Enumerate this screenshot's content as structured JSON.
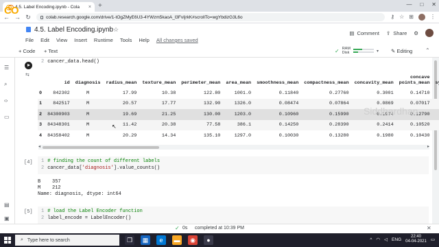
{
  "browser": {
    "tab_title": "4.5. Label Encoding.ipynb - Cola",
    "tab_close": "×",
    "new_tab": "+",
    "url": "colab.research.google.com/drive/1-tOgZMyE6U3-4YWzm5kaoA_l3FvIjrkK#scrollTo=wgYbdizG3L6o"
  },
  "colab": {
    "logo": "CO",
    "notebook_title": "4.5. Label Encoding.ipynb",
    "menu": [
      "File",
      "Edit",
      "View",
      "Insert",
      "Runtime",
      "Tools",
      "Help"
    ],
    "changes_status": "All changes saved",
    "comment_label": "Comment",
    "share_label": "Share",
    "add_code": "+ Code",
    "add_text": "+ Text",
    "ram_label": "RAM",
    "disk_label": "Disk",
    "ram_fraction": 0.45,
    "disk_fraction": 0.25,
    "editing_label": "Editing"
  },
  "cell1": {
    "line_no": "2",
    "code": "cancer_data.head()"
  },
  "table": {
    "columns": [
      "",
      "id",
      "diagnosis",
      "radius_mean",
      "texture_mean",
      "perimeter_mean",
      "area_mean",
      "smoothness_mean",
      "compactness_mean",
      "concavity_mean",
      "concave points_mean",
      "symm"
    ],
    "rows": [
      [
        "0",
        "842302",
        "M",
        "17.99",
        "10.38",
        "122.80",
        "1001.0",
        "0.11840",
        "0.27760",
        "0.3001",
        "0.14710",
        ""
      ],
      [
        "1",
        "842517",
        "M",
        "20.57",
        "17.77",
        "132.90",
        "1326.0",
        "0.08474",
        "0.07864",
        "0.0869",
        "0.07017",
        ""
      ],
      [
        "2",
        "84300903",
        "M",
        "19.69",
        "21.25",
        "130.00",
        "1203.0",
        "0.10960",
        "0.15990",
        "0.1974",
        "0.12790",
        ""
      ],
      [
        "3",
        "84348301",
        "M",
        "11.42",
        "20.38",
        "77.58",
        "386.1",
        "0.14250",
        "0.28390",
        "0.2414",
        "0.10520",
        ""
      ],
      [
        "4",
        "84358402",
        "M",
        "20.29",
        "14.34",
        "135.10",
        "1297.0",
        "0.10030",
        "0.13280",
        "0.1980",
        "0.10430",
        ""
      ]
    ]
  },
  "watermark": "Siddhardhan",
  "cell4": {
    "number": "[4]",
    "line1_no": "1",
    "line1": "# finding the count of different labels",
    "line2_no": "2",
    "line2_prefix": "cancer_data[",
    "line2_string": "'diagnosis'",
    "line2_suffix": "].value_counts()",
    "output": [
      "B    357",
      "M    212",
      "Name: diagnosis, dtype: int64"
    ]
  },
  "cell5": {
    "number": "[5]",
    "line1_no": "1",
    "line1": "# load the Label Encoder function",
    "line2_no": "2",
    "line2": "label_encode = LabelEncoder()"
  },
  "status": {
    "check": "✓",
    "time": "0s",
    "message": "completed at 10:39 PM"
  },
  "taskbar": {
    "search_placeholder": "Type here to search",
    "language": "ENG",
    "time": "22:40",
    "date": "04-04-2021"
  }
}
